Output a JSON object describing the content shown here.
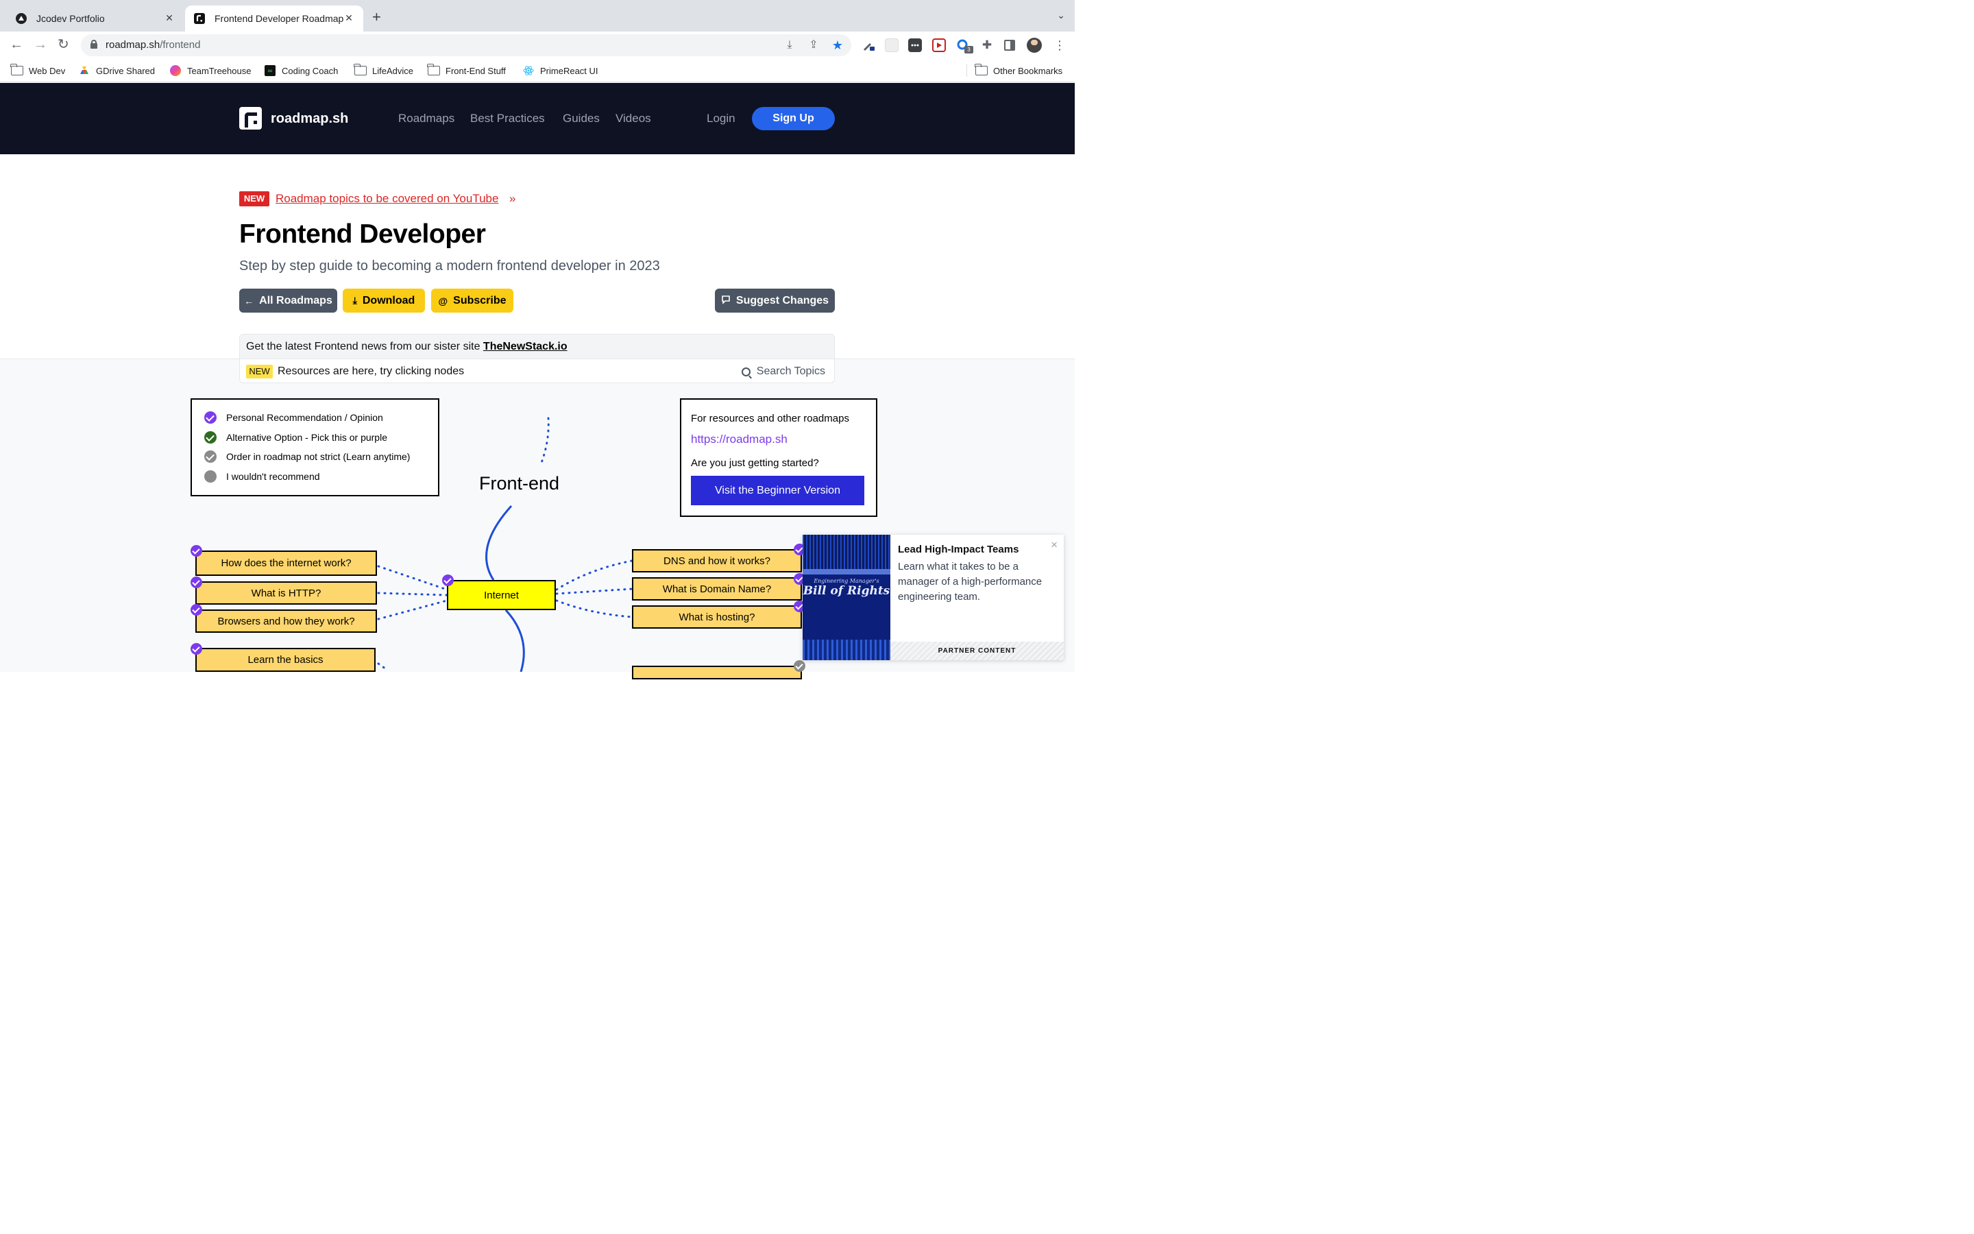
{
  "browser": {
    "tabs": [
      {
        "title": "Jcodev Portfolio",
        "icon": "triangle-logo-icon",
        "active": false
      },
      {
        "title": "Frontend Developer Roadmap",
        "icon": "roadmap-logo-icon",
        "active": true
      }
    ],
    "new_tab": "+",
    "url_host": "roadmap.sh",
    "url_path": "/frontend",
    "bookmarks": [
      {
        "label": "Web Dev",
        "icon": "folder-icon"
      },
      {
        "label": "GDrive Shared",
        "icon": "google-drive-icon"
      },
      {
        "label": "TeamTreehouse",
        "icon": "treehouse-icon"
      },
      {
        "label": "Coding Coach",
        "icon": "coding-coach-icon"
      },
      {
        "label": "LifeAdvice",
        "icon": "folder-icon"
      },
      {
        "label": "Front-End Stuff",
        "icon": "folder-icon"
      },
      {
        "label": "PrimeReact UI",
        "icon": "react-icon"
      }
    ],
    "other_bookmarks": "Other Bookmarks",
    "extension_badge": "3"
  },
  "site": {
    "logo_text": "roadmap.sh",
    "nav": [
      "Roadmaps",
      "Best Practices",
      "Guides",
      "Videos"
    ],
    "login": "Login",
    "signup": "Sign Up"
  },
  "hero": {
    "badge": "NEW",
    "youtube_link": "Roadmap topics to be covered on YouTube",
    "youtube_arrow": "»",
    "title": "Frontend Developer",
    "subtitle": "Step by step guide to becoming a modern frontend developer in 2023",
    "buttons": {
      "all_roadmaps": "All Roadmaps",
      "download": "Download",
      "subscribe": "Subscribe",
      "suggest": "Suggest Changes"
    }
  },
  "news": {
    "text": "Get the latest Frontend news from our sister site ",
    "link": "TheNewStack.io",
    "badge": "NEW",
    "resources_text": "Resources are here, try clicking nodes",
    "search": "Search Topics"
  },
  "legend": [
    {
      "label": "Personal Recommendation / Opinion",
      "color": "#7c3aed",
      "kind": "check"
    },
    {
      "label": "Alternative Option - Pick this or purple",
      "color": "#2f6b1f",
      "kind": "check"
    },
    {
      "label": "Order in roadmap not strict (Learn anytime)",
      "color": "#8a8a8a",
      "kind": "check"
    },
    {
      "label": "I wouldn't recommend",
      "color": "#8a8a8a",
      "kind": "dot"
    }
  ],
  "resources_box": {
    "heading": "For resources and other roadmaps",
    "url": "https://roadmap.sh",
    "question": "Are you just getting started?",
    "button": "Visit the Beginner Version"
  },
  "roadmap": {
    "root": "Front-end",
    "center": "Internet",
    "left_nodes": [
      "How does the internet work?",
      "What is HTTP?",
      "Browsers and how they work?",
      "Learn the basics"
    ],
    "right_nodes": [
      "DNS and how it works?",
      "What is Domain Name?",
      "What is hosting?"
    ]
  },
  "ad": {
    "image_kicker": "Engineering Manager's",
    "image_title": "Bill of Rights",
    "title": "Lead High-Impact Teams",
    "description": "Learn what it takes to be a manager of a high-performance engineering team.",
    "footer": "PARTNER CONTENT",
    "close": "×"
  },
  "colors": {
    "site_header_bg": "#0e1222",
    "signup_bg": "#2563eb",
    "new_badge": "#dc2626",
    "yellow_button": "#facc15",
    "node_fill": "#fdd66d",
    "center_node_fill": "#ffff00",
    "beginner_button": "#2a2ad6",
    "purple": "#7c3aed",
    "connector_blue": "#1d4ed8"
  }
}
